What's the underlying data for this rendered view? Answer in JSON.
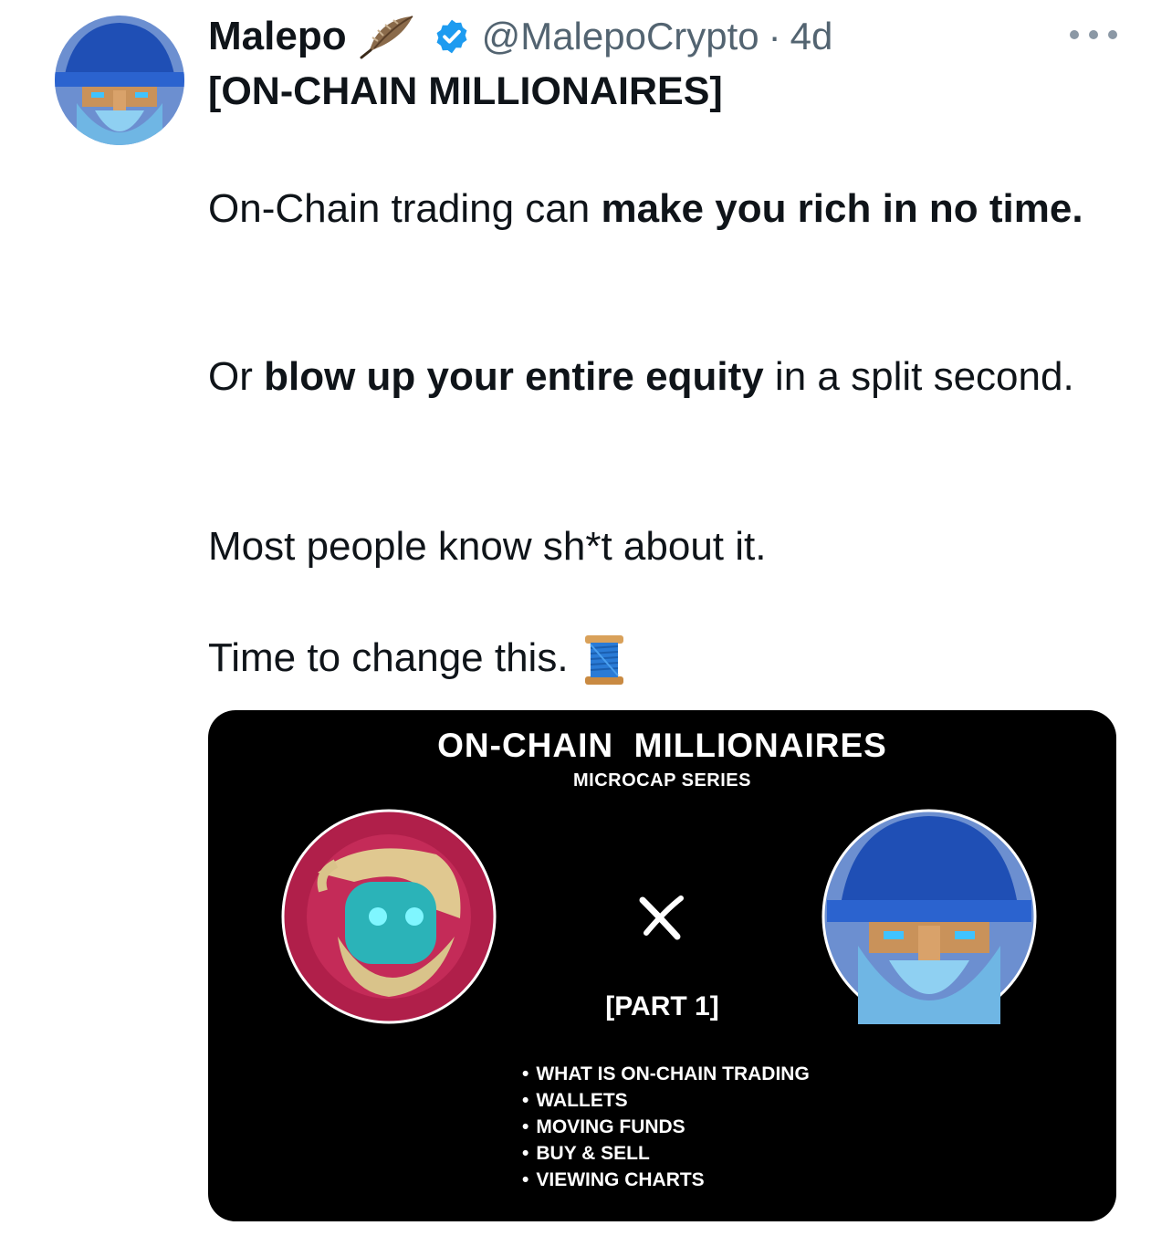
{
  "tweet": {
    "display_name": "Malepo",
    "handle": "@MalepoCrypto",
    "separator": "·",
    "time": "4d",
    "title": "[ON-CHAIN MILLIONAIRES]",
    "para1": {
      "pre": "On-Chain trading can ",
      "bold": "make you rich in no time."
    },
    "para2": {
      "pre": "Or ",
      "bold": "blow up your entire equity",
      "post": " in a split second."
    },
    "para3": "Most people know sh*t about it.",
    "para4": "Time to change this."
  },
  "card": {
    "title": "ON-CHAIN  MILLIONAIRES",
    "subtitle": "MICROCAP SERIES",
    "part": "[PART 1]",
    "bullets": [
      "WHAT IS ON-CHAIN TRADING",
      "WALLETS",
      "MOVING FUNDS",
      "BUY & SELL",
      "VIEWING CHARTS"
    ]
  },
  "icons": {
    "feather": "feather-icon",
    "verified": "verified-badge-icon",
    "more": "more-options-icon",
    "spool": "thread-spool-icon",
    "cross": "x-icon"
  },
  "colors": {
    "text": "#0f1419",
    "secondary": "#536471",
    "verified": "#1d9bf0",
    "card_bg": "#000000"
  }
}
